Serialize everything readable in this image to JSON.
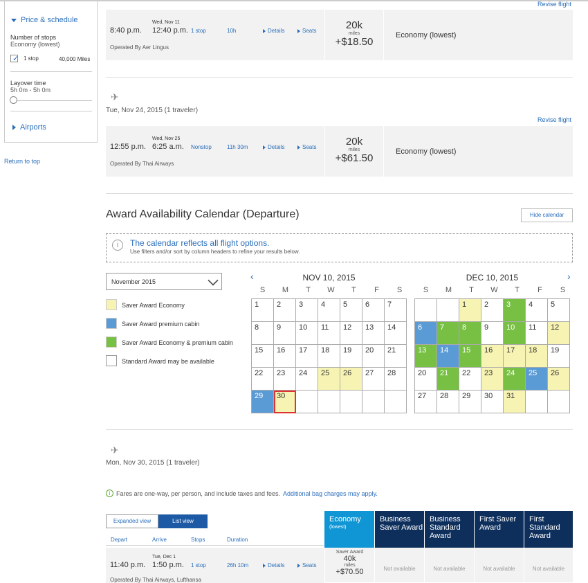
{
  "sidebar": {
    "price_schedule_label": "Price & schedule",
    "stops_label": "Number of stops",
    "stops_sub": "Economy (lowest)",
    "stop_option": "1 stop",
    "stop_miles": "40,000 Miles",
    "layover_label": "Layover time",
    "layover_range": "5h 0m - 5h 0m",
    "airports_label": "Airports",
    "return_top": "Return to top"
  },
  "flights": [
    {
      "revise": "Revise flight",
      "arr_date": "Wed, Nov 11",
      "depart": "8:40 p.m.",
      "arrive": "12:40 p.m.",
      "stops": "1 stop",
      "duration": "10h",
      "details": "Details",
      "seats": "Seats",
      "operated": "Operated By Aer Lingus",
      "miles": "20k",
      "miles_label": "miles",
      "fee": "+$18.50",
      "cabin": "Economy (lowest)"
    },
    {
      "trip_date": "Tue, Nov 24, 2015 (1 traveler)",
      "revise": "Revise flight",
      "arr_date": "Wed, Nov 25",
      "depart": "12:55 p.m.",
      "arrive": "6:25 a.m.",
      "stops": "Nonstop",
      "duration": "11h 30m",
      "details": "Details",
      "seats": "Seats",
      "operated": "Operated By Thai Airways",
      "miles": "20k",
      "miles_label": "miles",
      "fee": "+$61.50",
      "cabin": "Economy (lowest)"
    }
  ],
  "calendar": {
    "title": "Award Availability Calendar (Departure)",
    "hide_button": "Hide calendar",
    "notice_main": "The calendar reflects all flight options.",
    "notice_sub": "Use filters and/or sort by column headers to refine your results below.",
    "month_select": "November 2015",
    "legend": [
      {
        "label": "Saver Award Economy",
        "color": "#f7f4b3"
      },
      {
        "label": "Saver Award premium cabin",
        "color": "#5b9bd5"
      },
      {
        "label": "Saver Award Economy & premium cabin",
        "color": "#77c043"
      },
      {
        "label": "Standard Award may be available",
        "color": "#ffffff"
      }
    ],
    "dow": [
      "S",
      "M",
      "T",
      "W",
      "T",
      "F",
      "S"
    ],
    "months": [
      {
        "label": "NOV 10, 2015",
        "lead_blanks": 0,
        "days": 30,
        "yellow": [
          25,
          26,
          30
        ],
        "blue": [
          29
        ],
        "green": [],
        "selected": 30
      },
      {
        "label": "DEC 10, 2015",
        "lead_blanks": 2,
        "days": 31,
        "yellow": [
          1,
          12,
          16,
          17,
          18,
          23,
          26,
          31
        ],
        "blue": [
          6,
          14,
          25
        ],
        "green": [
          3,
          7,
          8,
          10,
          13,
          15,
          21,
          24
        ],
        "selected": null
      }
    ]
  },
  "trip2": {
    "date": "Mon, Nov 30, 2015 (1 traveler)",
    "fares_note": "Fares are one-way, per person, and include taxes and fees.",
    "bag_link": "Additional bag charges may apply.",
    "expanded_view": "Expanded view",
    "list_view": "List view",
    "cols": [
      "Depart",
      "Arrive",
      "Stops",
      "Duration"
    ],
    "fare_heads": [
      {
        "title": "Economy",
        "sub": "(lowest)"
      },
      {
        "title": "Business Saver Award",
        "sub": ""
      },
      {
        "title": "Business Standard Award",
        "sub": ""
      },
      {
        "title": "First Saver Award",
        "sub": ""
      },
      {
        "title": "First Standard Award",
        "sub": ""
      }
    ],
    "row": {
      "arr_date": "Tue, Dec 1",
      "depart": "11:40 p.m.",
      "arrive": "1:50 p.m.",
      "stops": "1 stop",
      "duration": "26h 10m",
      "details": "Details",
      "seats": "Seats",
      "operated": "Operated By Thai Airways, Lufthansa",
      "saver_label": "Saver Award",
      "miles": "40k",
      "miles_label": "miles",
      "fee": "+$70.50",
      "na": "Not available"
    }
  }
}
